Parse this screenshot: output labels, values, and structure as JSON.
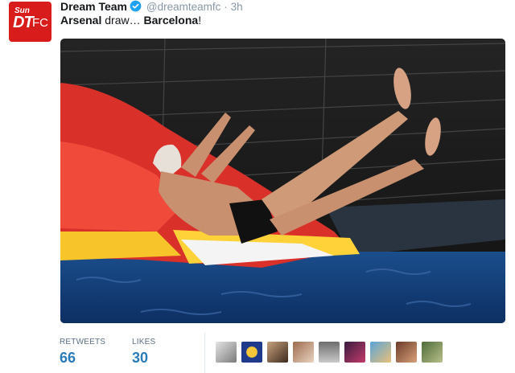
{
  "tweet": {
    "display_name": "Dream Team",
    "handle": "@dreamteamfc",
    "separator": "·",
    "time": "3h",
    "text_part1": "Arsenal",
    "text_part2": " draw… ",
    "text_part3": "Barcelona",
    "text_part4": "!",
    "avatar": {
      "small": "Sun",
      "big": "DT",
      "suffix": "FC"
    },
    "photo_description": "man sliding down inflatable slide into sea"
  },
  "stats": {
    "retweets_label": "RETWEETS",
    "retweets_value": "66",
    "likes_label": "LIKES",
    "likes_value": "30"
  },
  "likers_count": 9,
  "colors": {
    "accent": "#2b7bb9",
    "brand": "#d81c1c",
    "muted": "#8899a6"
  }
}
